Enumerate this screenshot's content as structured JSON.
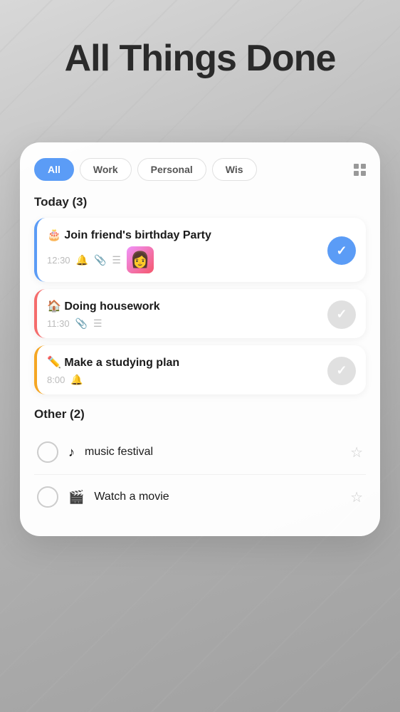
{
  "app": {
    "title": "All Things Done"
  },
  "filters": {
    "tabs": [
      {
        "id": "all",
        "label": "All",
        "active": true
      },
      {
        "id": "work",
        "label": "Work",
        "active": false
      },
      {
        "id": "personal",
        "label": "Personal",
        "active": false
      },
      {
        "id": "wish",
        "label": "Wis",
        "active": false
      }
    ]
  },
  "today_section": {
    "header": "Today (3)",
    "tasks": [
      {
        "id": "birthday",
        "emoji": "🎂",
        "title": "Join friend's birthday Party",
        "time": "12:30",
        "has_bell": true,
        "has_clip": true,
        "has_list": true,
        "has_thumb": true,
        "done": true,
        "accent": "blue"
      },
      {
        "id": "housework",
        "emoji": "🏠",
        "title": "Doing housework",
        "time": "11:30",
        "has_bell": false,
        "has_clip": true,
        "has_list": true,
        "done": false,
        "accent": "pink"
      },
      {
        "id": "study",
        "emoji": "✏️",
        "title": "Make a studying plan",
        "time": "8:00",
        "has_bell": true,
        "done": false,
        "accent": "yellow"
      }
    ]
  },
  "other_section": {
    "header": "Other (2)",
    "tasks": [
      {
        "id": "music",
        "icon": "♪",
        "title": "music festival",
        "starred": false
      },
      {
        "id": "movie",
        "icon": "🎬",
        "title": "Watch a movie",
        "starred": false
      }
    ]
  }
}
